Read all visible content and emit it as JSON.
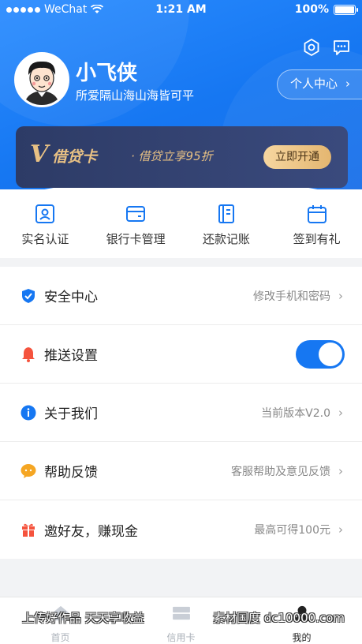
{
  "status": {
    "carrier": "WeChat",
    "time": "1:21 AM",
    "battery": "100%"
  },
  "profile": {
    "name": "小飞侠",
    "signature": "所爱隔山海山海皆可平",
    "center_button": "个人中心"
  },
  "promo": {
    "v": "V",
    "title": "借贷卡",
    "subtitle": "· 借贷立享95折",
    "button": "立即开通"
  },
  "quick": [
    {
      "label": "实名认证",
      "icon": "id-card-icon"
    },
    {
      "label": "银行卡管理",
      "icon": "bank-card-icon"
    },
    {
      "label": "还款记账",
      "icon": "notebook-icon"
    },
    {
      "label": "签到有礼",
      "icon": "calendar-icon"
    }
  ],
  "menu": [
    {
      "label": "安全中心",
      "value": "修改手机和密码",
      "icon": "shield-icon",
      "color": "#1677f2"
    },
    {
      "label": "推送设置",
      "toggle_on": true,
      "icon": "bell-icon",
      "color": "#f5533d"
    },
    {
      "label": "关于我们",
      "value": "当前版本V2.0",
      "icon": "info-icon",
      "color": "#1677f2"
    },
    {
      "label": "帮助反馈",
      "value": "客服帮助及意见反馈",
      "icon": "chat-icon",
      "color": "#f5a623"
    },
    {
      "label": "邀好友，赚现金",
      "value": "最高可得100元",
      "icon": "gift-icon",
      "color": "#f5533d"
    }
  ],
  "tabs": [
    {
      "label": "首页",
      "icon": "home-icon"
    },
    {
      "label": "信用卡",
      "icon": "credit-card-icon"
    },
    {
      "label": "我的",
      "icon": "user-icon",
      "active": true
    }
  ],
  "watermark": {
    "left": "上传好作品 天天享收益",
    "right": "素材国度 dc10000.com"
  }
}
